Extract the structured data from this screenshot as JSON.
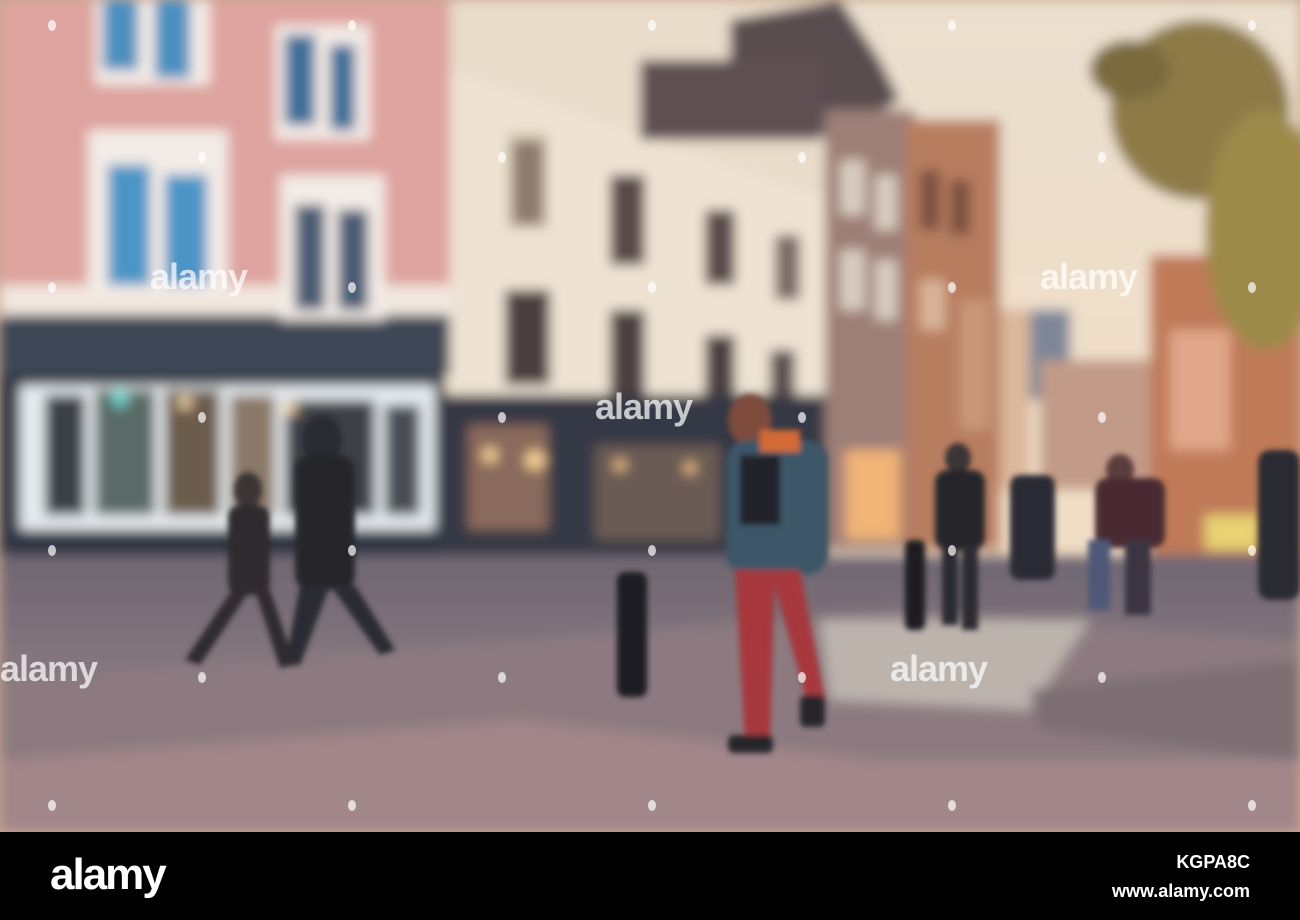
{
  "photo": {
    "description_icon": "blurred-street-photo",
    "watermarks": [
      "alamy",
      "alamy",
      "alamy",
      "alamy",
      "alamy",
      "alamy",
      "alamy"
    ],
    "colors": {
      "sky": "#efe2cc",
      "pink_building": "#e2a7a1",
      "white_building": "#ede2d2",
      "pavement": "#8f7f86"
    }
  },
  "footer": {
    "logo": "alamy",
    "image_id": "KGPA8C",
    "url": "www.alamy.com"
  }
}
